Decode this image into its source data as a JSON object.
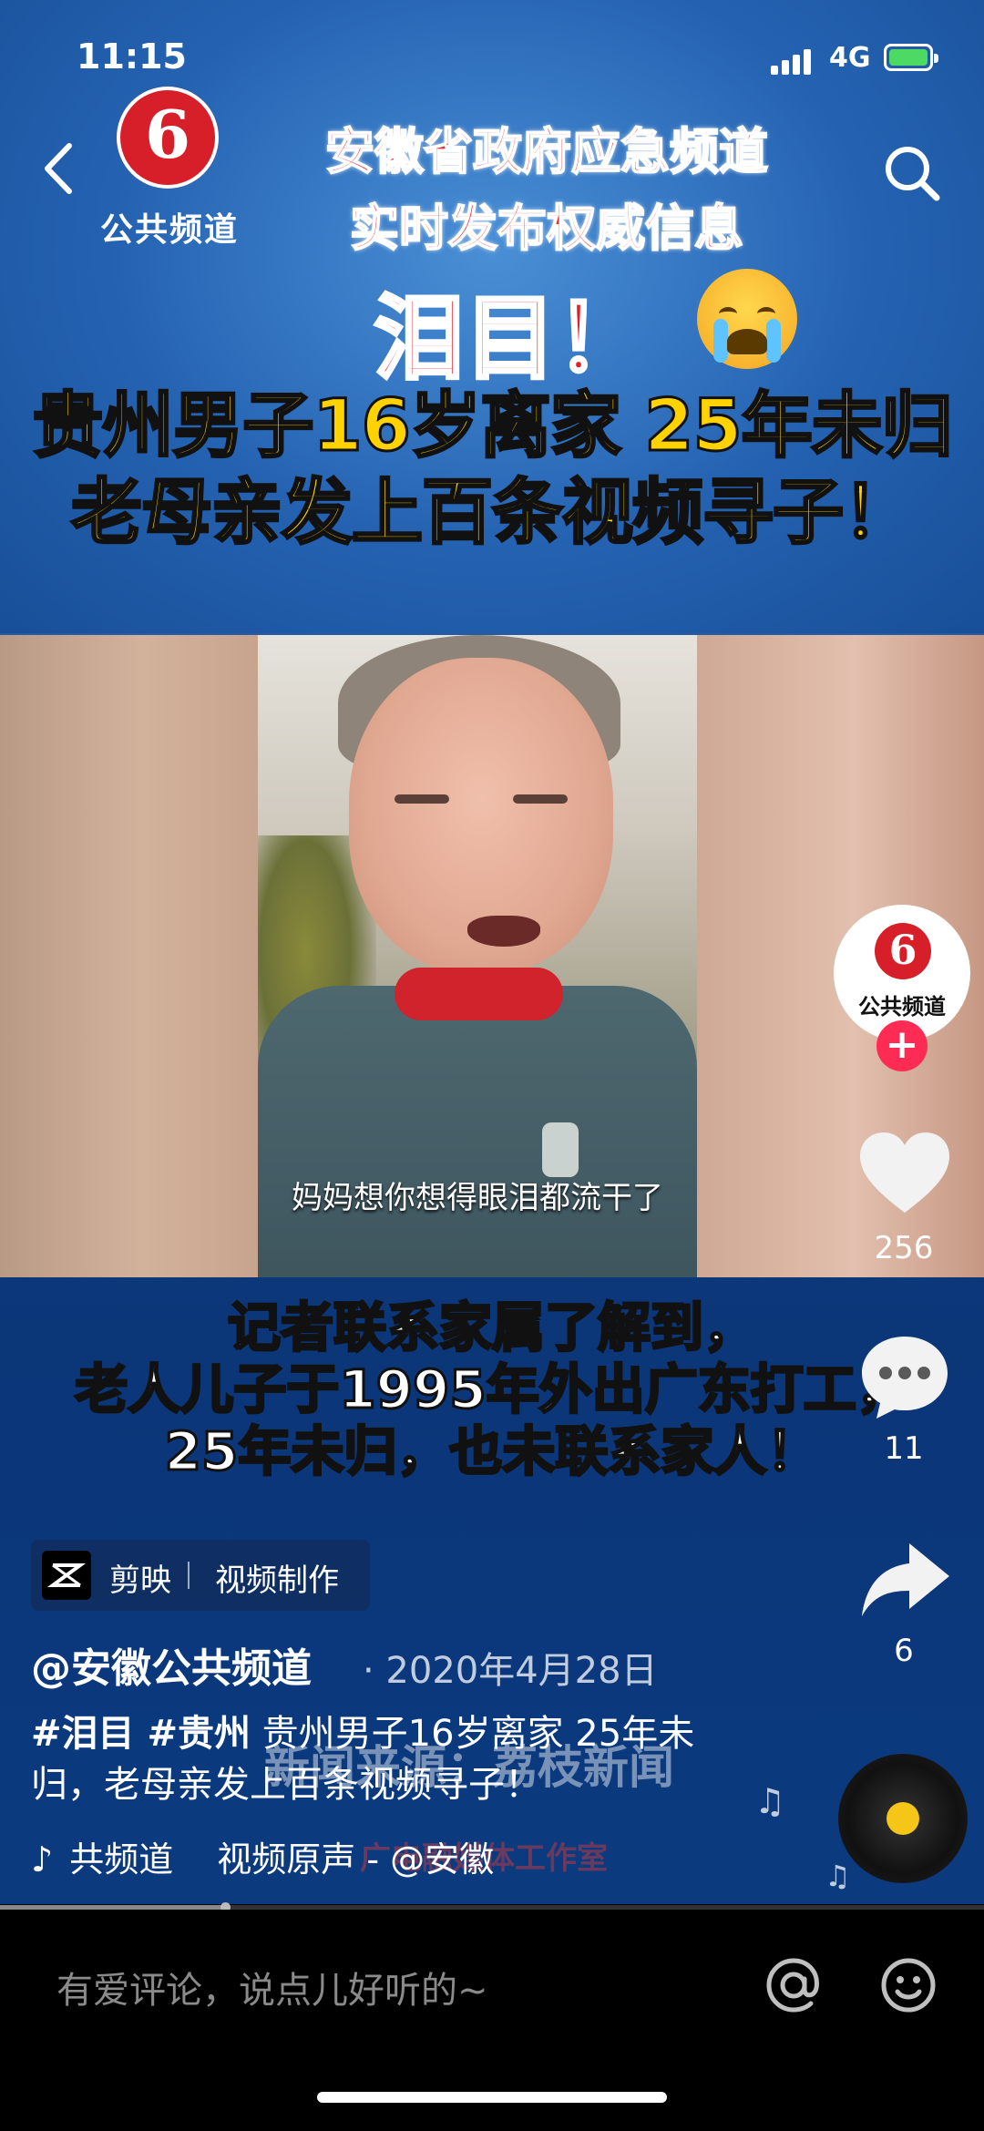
{
  "status": {
    "time": "11:15",
    "network": "4G"
  },
  "logo": {
    "channel_name": "公共频道",
    "glyph": "6"
  },
  "banner": {
    "line1": "安徽省政府应急频道",
    "line2": "实时发布权威信息",
    "headline": "泪目！",
    "title1": "贵州男子16岁离家 25年未归",
    "title2": "老母亲发上百条视频寻子！"
  },
  "video": {
    "subtitle": "妈妈想你想得眼泪都流干了",
    "caption_lines": [
      "记者联系家属了解到，",
      "老人儿子于1995年外出广东打工，",
      "25年未归，也未联系家人！"
    ],
    "watermark": "新闻来源：荔枝新闻",
    "watermark2": "广电融媒体工作室"
  },
  "capcut": {
    "app": "剪映",
    "label": "视频制作"
  },
  "post": {
    "author": "@安徽公共频道",
    "date": "· 2020年4月28日",
    "tags": "#泪目 #贵州",
    "text": " 贵州男子16岁离家 25年未归，老母亲发上百条视频寻子！",
    "music_left": "共频道",
    "music_right": "视频原声 - @安徽"
  },
  "side": {
    "avatar_text": "公共频道",
    "likes": "256",
    "comments": "11",
    "shares": "6"
  },
  "comment_bar": {
    "placeholder": "有爱评论，说点儿好听的~"
  },
  "progress": {
    "fraction": 0.23
  },
  "colors": {
    "accent": "#fe2c55",
    "brand_red": "#d71f2a",
    "title_yellow": "#ffd200"
  }
}
